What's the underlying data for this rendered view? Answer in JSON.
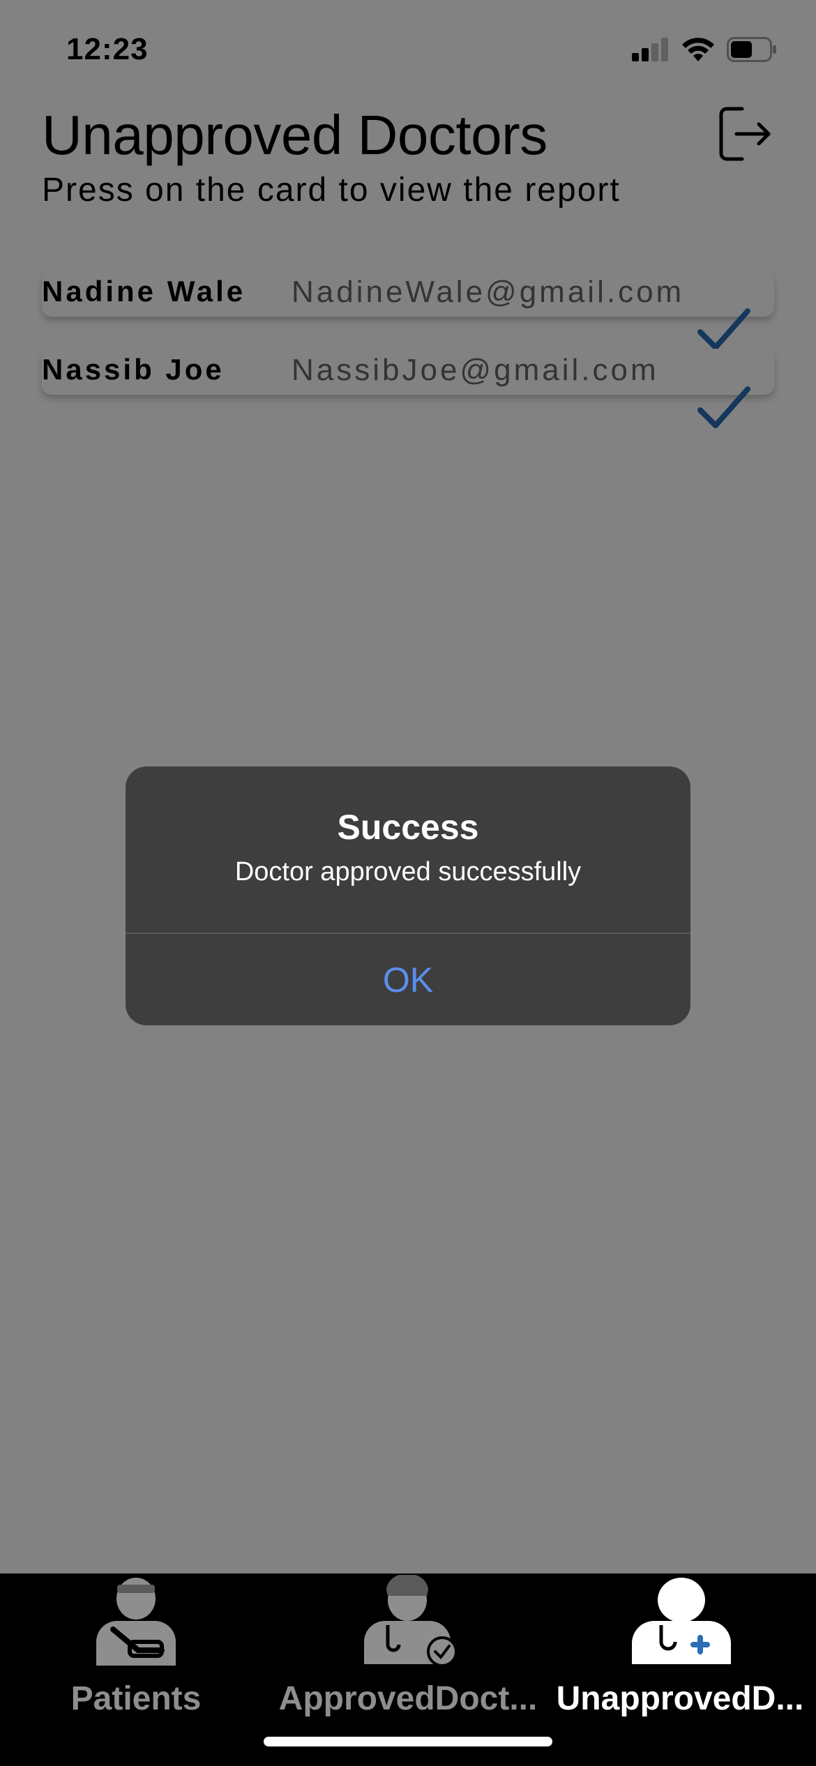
{
  "status_bar": {
    "time": "12:23"
  },
  "header": {
    "title": "Unapproved Doctors",
    "subtitle": "Press on the card to view the report"
  },
  "doctors": [
    {
      "name": "Nadine Wale",
      "email": "NadineWale@gmail.com"
    },
    {
      "name": "Nassib Joe",
      "email": "NassibJoe@gmail.com"
    }
  ],
  "dialog": {
    "title": "Success",
    "message": "Doctor approved successfully",
    "ok_label": "OK"
  },
  "tabs": [
    {
      "label": "Patients",
      "icon": "patient-icon",
      "active": false
    },
    {
      "label": "ApprovedDoct...",
      "icon": "approved-doctor-icon",
      "active": false
    },
    {
      "label": "UnapprovedD...",
      "icon": "unapproved-doctor-icon",
      "active": true
    }
  ],
  "colors": {
    "check": "#2a6db5",
    "ok_button": "#5b8fef",
    "dialog_bg": "#3e3e3e",
    "tab_active": "#ffffff",
    "tab_inactive": "#8e8e8e"
  }
}
